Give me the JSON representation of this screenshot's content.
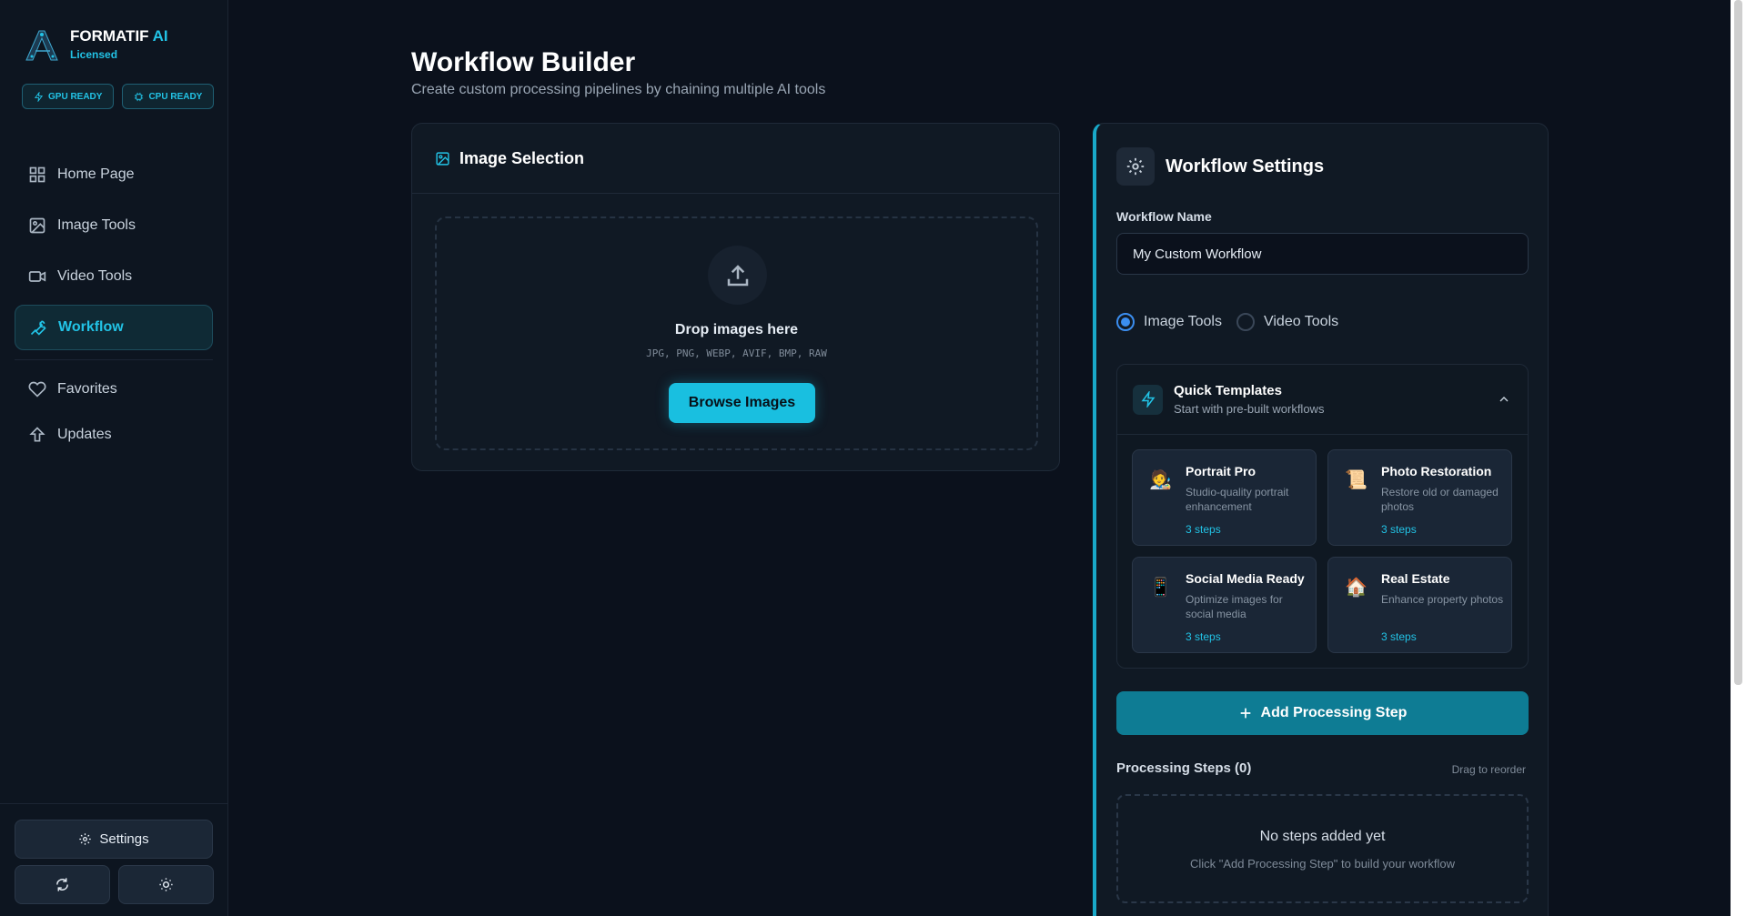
{
  "brand": {
    "name": "FORMATIF",
    "name_accent": "AI",
    "status": "Licensed"
  },
  "badges": {
    "gpu": "GPU READY",
    "cpu": "CPU READY"
  },
  "nav": {
    "items": [
      {
        "label": "Home Page",
        "icon": "grid-icon"
      },
      {
        "label": "Image Tools",
        "icon": "image-icon"
      },
      {
        "label": "Video Tools",
        "icon": "video-icon"
      },
      {
        "label": "Workflow",
        "icon": "wrench-icon",
        "active": true
      }
    ],
    "secondary": [
      {
        "label": "Favorites",
        "icon": "heart-icon"
      },
      {
        "label": "Updates",
        "icon": "arrow-up-icon"
      }
    ]
  },
  "footer": {
    "settings_label": "Settings"
  },
  "page": {
    "title": "Workflow Builder",
    "subtitle": "Create custom processing pipelines by chaining multiple AI tools"
  },
  "image_selection": {
    "title": "Image Selection",
    "drop_text": "Drop images here",
    "formats": "JPG, PNG, WEBP, AVIF, BMP, RAW",
    "browse_label": "Browse Images"
  },
  "workflow_settings": {
    "title": "Workflow Settings",
    "name_label": "Workflow Name",
    "name_value": "My Custom Workflow",
    "radio_image": "Image Tools",
    "radio_video": "Video Tools",
    "selected_type": "Image Tools",
    "quick_templates": {
      "title": "Quick Templates",
      "subtitle": "Start with pre-built workflows",
      "templates": [
        {
          "emoji": "🧑‍🎨",
          "name": "Portrait Pro",
          "desc": "Studio-quality portrait enhancement",
          "steps": "3 steps"
        },
        {
          "emoji": "📜",
          "name": "Photo Restoration",
          "desc": "Restore old or damaged photos",
          "steps": "3 steps"
        },
        {
          "emoji": "📱",
          "name": "Social Media Ready",
          "desc": "Optimize images for social media",
          "steps": "3 steps"
        },
        {
          "emoji": "🏠",
          "name": "Real Estate",
          "desc": "Enhance property photos",
          "steps": "3 steps"
        }
      ]
    },
    "add_step_label": "Add Processing Step",
    "steps_title": "Processing Steps (0)",
    "drag_hint": "Drag to reorder",
    "empty_title": "No steps added yet",
    "empty_hint": "Click \"Add Processing Step\" to build your workflow"
  },
  "colors": {
    "accent": "#22c3e6",
    "background": "#0b111c",
    "primary_button": "#0e7c94"
  }
}
